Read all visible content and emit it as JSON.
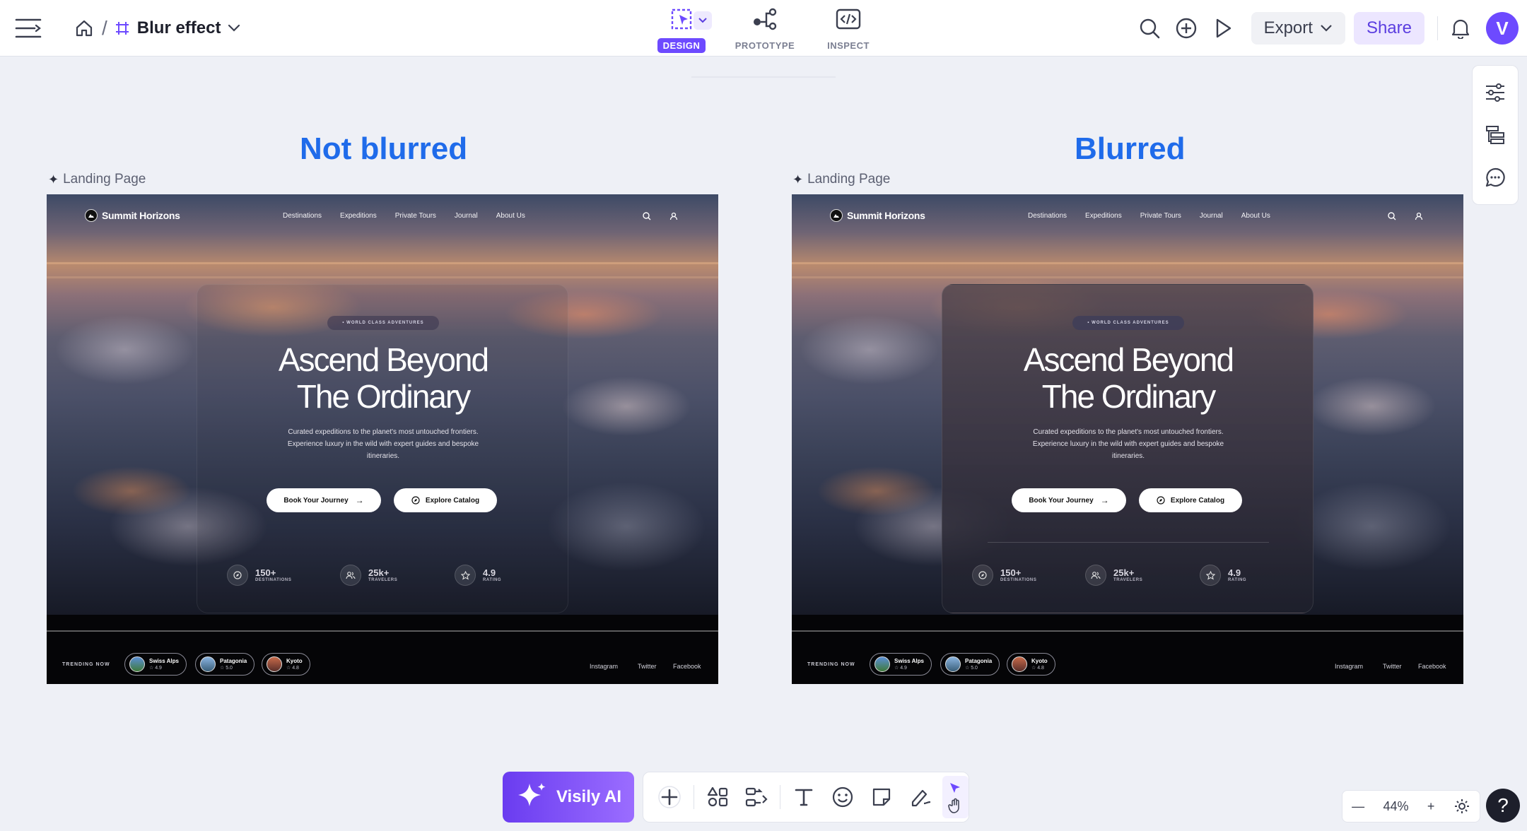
{
  "topbar": {
    "file_title": "Blur effect",
    "modes": [
      {
        "label": "DESIGN",
        "active": true
      },
      {
        "label": "PROTOTYPE",
        "active": false
      },
      {
        "label": "INSPECT",
        "active": false
      }
    ],
    "export_label": "Export",
    "share_label": "Share",
    "avatar_letter": "V"
  },
  "canvas": {
    "left": {
      "section_title": "Not blurred",
      "frame_label": "Landing Page"
    },
    "right": {
      "section_title": "Blurred",
      "frame_label": "Landing Page"
    }
  },
  "site": {
    "brand": "Summit Horizons",
    "nav": [
      "Destinations",
      "Expeditions",
      "Private Tours",
      "Journal",
      "About Us"
    ],
    "chip": "• WORLD CLASS ADVENTURES",
    "title_line1": "Ascend Beyond",
    "title_line2": "The Ordinary",
    "description": "Curated expeditions to the planet's most untouched frontiers. Experience luxury in the wild with expert guides and bespoke itineraries.",
    "primary_cta": "Book Your Journey",
    "secondary_cta": "Explore Catalog",
    "stats": [
      {
        "value": "150+",
        "label": "DESTINATIONS"
      },
      {
        "value": "25k+",
        "label": "TRAVELERS"
      },
      {
        "value": "4.9",
        "label": "RATING"
      }
    ],
    "trending_label": "TRENDING NOW",
    "trending": [
      {
        "name": "Swiss Alps",
        "rating": "☆ 4.9"
      },
      {
        "name": "Patagonia",
        "rating": "☆ 5.0"
      },
      {
        "name": "Kyoto",
        "rating": "☆ 4.8"
      }
    ],
    "socials": [
      "Instagram",
      "Twitter",
      "Facebook"
    ]
  },
  "bottom": {
    "ai_label": "Visily AI",
    "zoom_level": "44%",
    "help_label": "?"
  },
  "colors": {
    "accent": "#6d4aff",
    "section_title": "#1f6bea"
  }
}
